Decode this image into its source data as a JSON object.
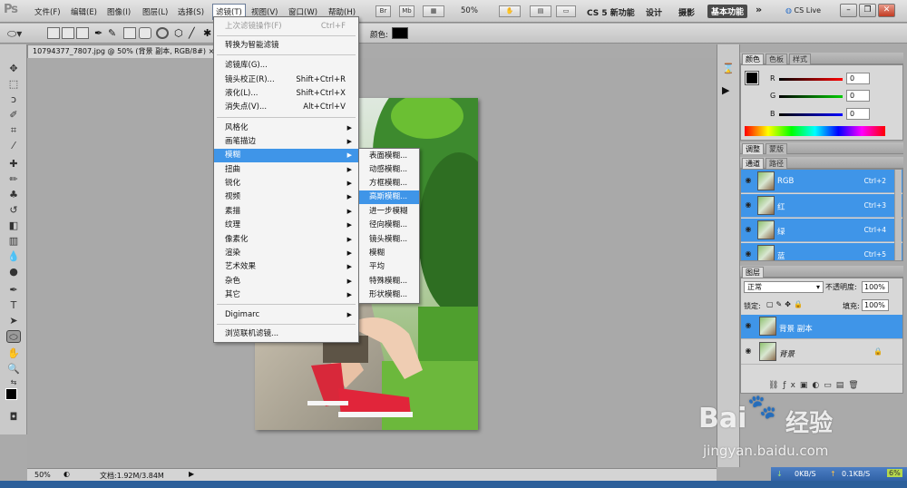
{
  "app": {
    "logo": "Ps"
  },
  "menubar": {
    "items": [
      "文件(F)",
      "编辑(E)",
      "图像(I)",
      "图层(L)",
      "选择(S)",
      "滤镜(T)",
      "视图(V)",
      "窗口(W)",
      "帮助(H)"
    ],
    "br_label": "Br",
    "mb_label": "Mb",
    "zoom": "50%",
    "workspaces": [
      "CS 5 新功能",
      "设计",
      "摄影",
      "基本功能"
    ],
    "more": "»",
    "cs_live": "CS Live"
  },
  "options": {
    "color_label": "颜色:",
    "color_value": "#000000"
  },
  "document": {
    "tab_title": "10794377_7807.jpg @ 50% (背景 副本, RGB/8#)"
  },
  "filter_menu": {
    "items": [
      {
        "label": "上次滤镜操作(F)",
        "shortcut": "Ctrl+F",
        "disabled": true
      },
      {
        "label": "转换为智能滤镜",
        "shortcut": ""
      },
      {
        "label": "滤镜库(G)...",
        "shortcut": ""
      },
      {
        "label": "镜头校正(R)...",
        "shortcut": "Shift+Ctrl+R"
      },
      {
        "label": "液化(L)...",
        "shortcut": "Shift+Ctrl+X"
      },
      {
        "label": "消失点(V)...",
        "shortcut": "Alt+Ctrl+V"
      },
      {
        "label": "风格化",
        "shortcut": ""
      },
      {
        "label": "画笔描边",
        "shortcut": ""
      },
      {
        "label": "模糊",
        "shortcut": ""
      },
      {
        "label": "扭曲",
        "shortcut": ""
      },
      {
        "label": "锐化",
        "shortcut": ""
      },
      {
        "label": "视频",
        "shortcut": ""
      },
      {
        "label": "素描",
        "shortcut": ""
      },
      {
        "label": "纹理",
        "shortcut": ""
      },
      {
        "label": "像素化",
        "shortcut": ""
      },
      {
        "label": "渲染",
        "shortcut": ""
      },
      {
        "label": "艺术效果",
        "shortcut": ""
      },
      {
        "label": "杂色",
        "shortcut": ""
      },
      {
        "label": "其它",
        "shortcut": ""
      },
      {
        "label": "Digimarc",
        "shortcut": ""
      },
      {
        "label": "浏览联机滤镜...",
        "shortcut": ""
      }
    ]
  },
  "blur_submenu": {
    "items": [
      "表面模糊...",
      "动感模糊...",
      "方框模糊...",
      "高斯模糊...",
      "进一步模糊",
      "径向模糊...",
      "镜头模糊...",
      "模糊",
      "平均",
      "特殊模糊...",
      "形状模糊..."
    ]
  },
  "color_panel": {
    "tabs": [
      "颜色",
      "色板",
      "样式"
    ],
    "r_label": "R",
    "g_label": "G",
    "b_label": "B",
    "r": "0",
    "g": "0",
    "b": "0"
  },
  "adjust_panel": {
    "tabs": [
      "调整",
      "蒙版"
    ]
  },
  "channels_panel": {
    "tabs": [
      "通道",
      "路径"
    ],
    "rows": [
      {
        "name": "RGB",
        "shortcut": "Ctrl+2"
      },
      {
        "name": "红",
        "shortcut": "Ctrl+3"
      },
      {
        "name": "绿",
        "shortcut": "Ctrl+4"
      },
      {
        "name": "蓝",
        "shortcut": "Ctrl+5"
      }
    ]
  },
  "layers_panel": {
    "tab": "图层",
    "blend_mode": "正常",
    "opacity_label": "不透明度:",
    "opacity": "100%",
    "lock_label": "锁定:",
    "fill_label": "填充:",
    "fill": "100%",
    "layers": [
      {
        "name": "背景 副本"
      },
      {
        "name": "背景"
      }
    ]
  },
  "statusbar": {
    "zoom": "50%",
    "doc_info": "文档:1.92M/3.84M"
  },
  "netspeed": {
    "down": "0KB/S",
    "up": "0.1KB/S",
    "cpu": "6%"
  },
  "watermark": {
    "brand": "Bai",
    "brand2": "经验",
    "url": "jingyan.baidu.com"
  }
}
